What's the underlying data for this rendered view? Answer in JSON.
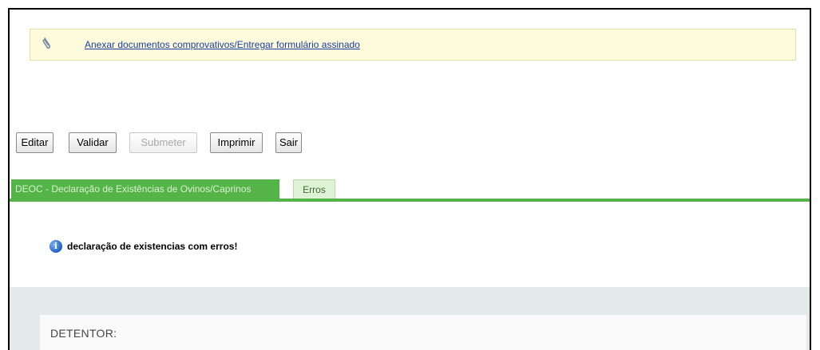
{
  "notice": {
    "link_text": "Anexar documentos comprovativos/Entregar formulário assinado",
    "icon": "paperclip-icon"
  },
  "toolbar": {
    "edit_label": "Editar",
    "validate_label": "Validar",
    "submit_label": "Submeter",
    "print_label": "Imprimir",
    "exit_label": "Sair"
  },
  "tabs": [
    {
      "label": "DEOC - Declaração de Existências de Ovinos/Caprinos",
      "active": true
    },
    {
      "label": "Erros",
      "active": false
    }
  ],
  "message": {
    "icon": "info-icon",
    "text": "declaração de existencias com erros!"
  },
  "section": {
    "title": "DETENTOR:"
  },
  "colors": {
    "notice_bg": "#fdfbdc",
    "tab_active": "#55b448",
    "tab_inactive": "#dff2d6",
    "link": "#1a3f9e",
    "panel_bg": "#e4eaeb"
  }
}
